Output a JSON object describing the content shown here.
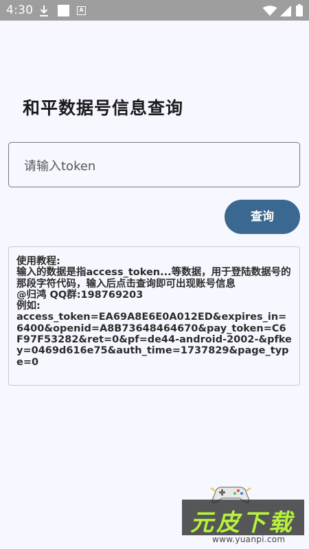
{
  "status_bar": {
    "time": "4:30",
    "icons": [
      "download-icon",
      "square-icon",
      "a-icon",
      "wifi-icon",
      "signal-icon",
      "battery-icon"
    ],
    "a_glyph": "A"
  },
  "page": {
    "title": "和平数据号信息查询"
  },
  "token_input": {
    "placeholder": "请输入token",
    "value": ""
  },
  "query_button": {
    "label": "查询",
    "color": "#3a6890"
  },
  "tutorial": {
    "lines": [
      "使用教程:",
      "输入的数据是指access_token...等数据，用于登陆数据号的那段字符代码，输入后点击查询即可出现账号信息",
      "@归鸿  QQ群:198769203",
      "例如:",
      "access_token=EA69A8E6E0A012ED&expires_in=6400&openid=A8B73648464670&pay_token=C6F97F53282&ret=0&pf=de44-android-2002-&pfkey=0469d616e75&auth_time=1737829&page_type=0"
    ]
  },
  "watermark": {
    "logo_text": "元皮下载",
    "url": "www.yuanpi.com",
    "icon": "game-controller-icon"
  }
}
